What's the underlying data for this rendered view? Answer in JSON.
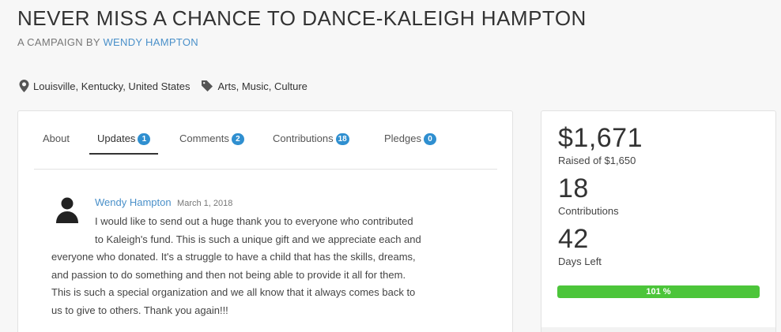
{
  "campaign": {
    "title": "NEVER MISS A CHANCE TO DANCE-KALEIGH HAMPTON",
    "byline_prefix": "A CAMPAIGN BY",
    "author": "WENDY HAMPTON",
    "location": "Louisville, Kentucky, United States",
    "category": "Arts, Music, Culture",
    "icons": [
      "map-marker-icon",
      "tag-icon"
    ]
  },
  "tabs": [
    {
      "label": "About",
      "count": null
    },
    {
      "label": "Updates",
      "count": "1"
    },
    {
      "label": "Comments",
      "count": "2"
    },
    {
      "label": "Contributions",
      "count": "18"
    },
    {
      "label": "Pledges",
      "count": "0"
    }
  ],
  "update": {
    "author": "Wendy Hampton",
    "date": "March 1, 2018",
    "lines_indented": [
      "I would like to send out a huge thank you to everyone who contributed",
      "to Kaleigh's fund. This is such a unique gift and we appreciate each and"
    ],
    "lines": [
      "everyone who donated. It's a struggle to have a child that has the skills, dreams,",
      "and passion to do something and then not being able to provide it all for them.",
      "This is such a special organization and we all know that it always comes back to",
      "us to give to others. Thank you again!!!"
    ]
  },
  "stats": {
    "raised": "$1,671",
    "raised_label": "Raised of $1,650",
    "contributions": "18",
    "contributions_label": "Contributions",
    "days_left": "42",
    "days_left_label": "Days Left",
    "progress_text": "101 %",
    "progress_fraction": 1.0
  },
  "colors": {
    "accent": "#4a90c9",
    "badge": "#2f8fd0",
    "progress": "#4cc53a"
  }
}
